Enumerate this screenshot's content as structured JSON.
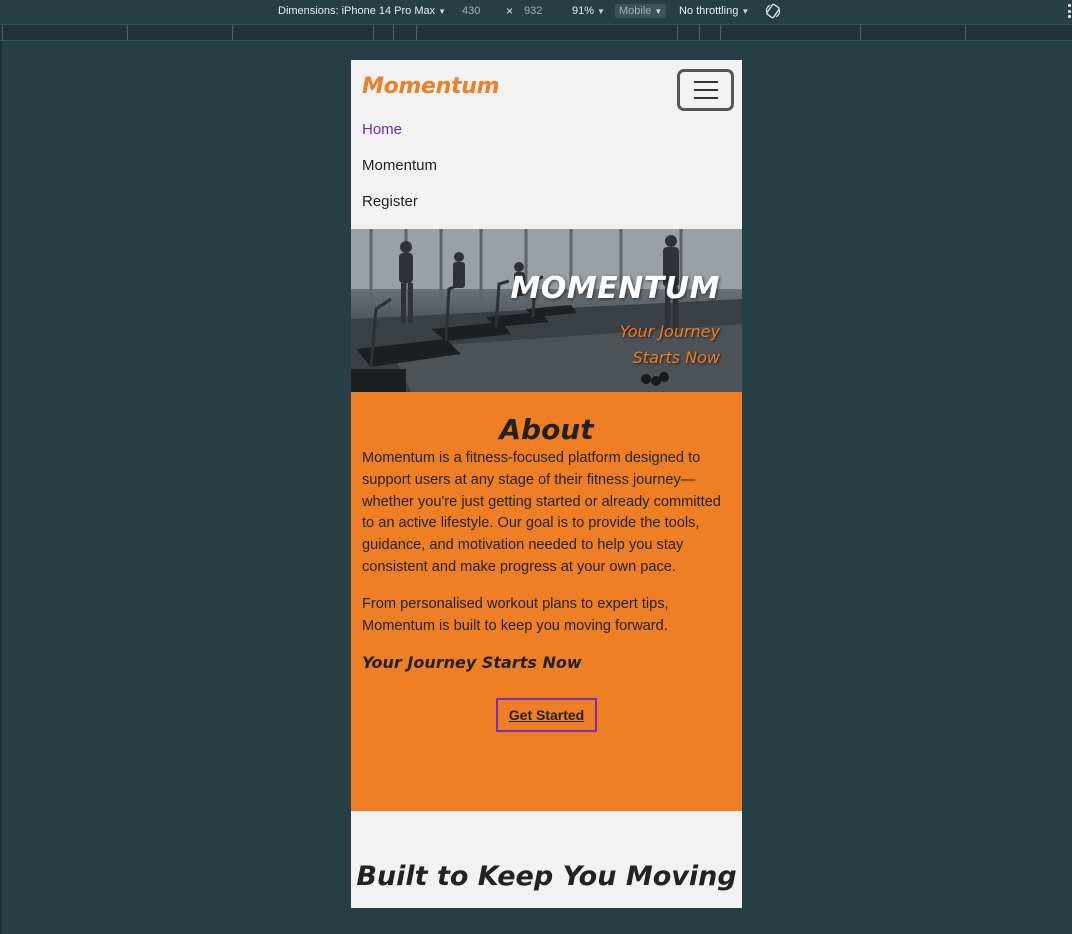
{
  "devtools": {
    "dimensions_label": "Dimensions: iPhone 14 Pro Max",
    "width": "430",
    "times": "×",
    "height": "932",
    "zoom": "91%",
    "mode": "Mobile",
    "throttling": "No throttling"
  },
  "site": {
    "logo": "Momentum",
    "nav": [
      {
        "label": "Home"
      },
      {
        "label": "Momentum"
      },
      {
        "label": "Register"
      }
    ],
    "hero": {
      "title": "MOMENTUM",
      "subtitle": "Your Journey Starts Now"
    },
    "about": {
      "heading": "About",
      "paragraph1": "Momentum is a fitness-focused platform designed to support users at any stage of their fitness journey—whether you're just getting started or already committed to an active lifestyle. Our goal is to provide the tools, guidance, and motivation needed to help you stay consistent and make progress at your own pace.",
      "paragraph2": "From personalised workout plans to expert tips, Momentum is built to keep you moving forward.",
      "tagline": "Your Journey Starts Now",
      "cta": "Get Started"
    },
    "section2": {
      "heading": "Built to Keep You Moving"
    }
  },
  "colors": {
    "page_bg": "#263f45",
    "brand_orange": "#ee7f24",
    "active_link": "#6a2ea8",
    "cta_border": "#7c2fb5"
  }
}
